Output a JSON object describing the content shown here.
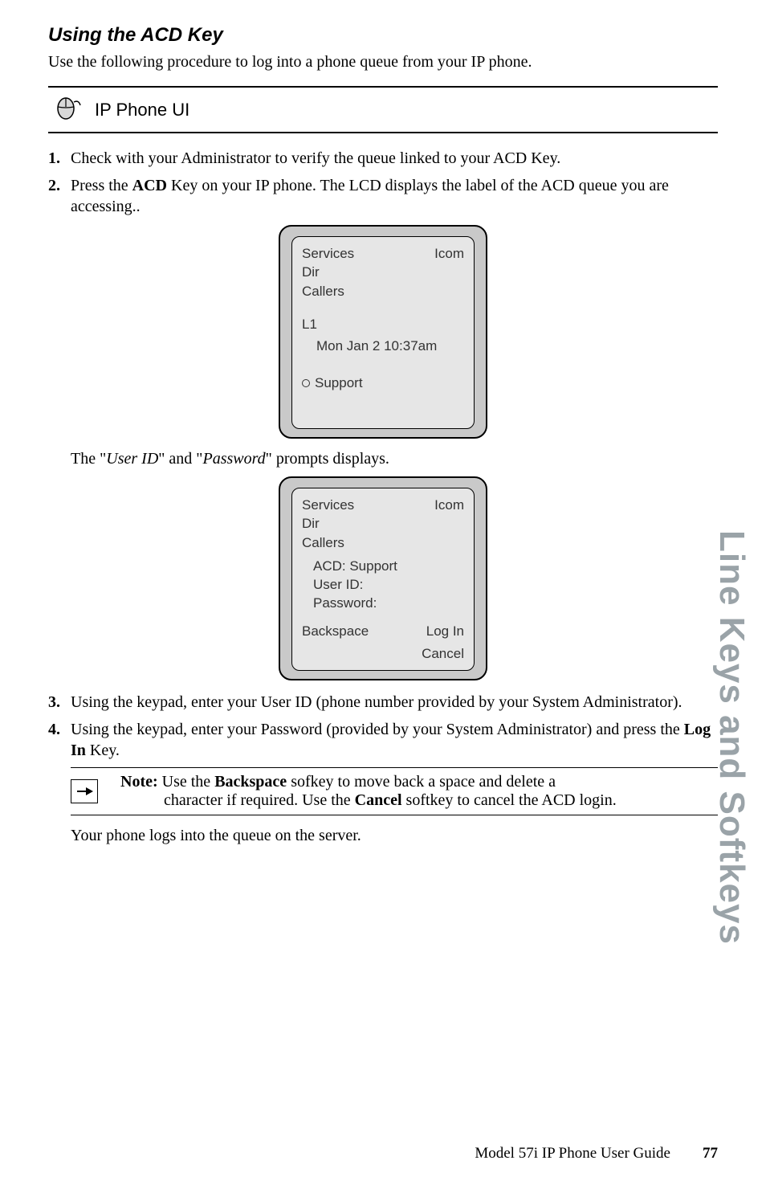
{
  "section_title": "Using the ACD Key",
  "intro": "Use the following procedure to log into a phone queue from your IP phone.",
  "ui_banner_label": "IP Phone UI",
  "steps": {
    "s1": "Check with your Administrator to verify the queue linked to your ACD Key.",
    "s2_a": "Press the ",
    "s2_b": "ACD",
    "s2_c": " Key on your IP phone. The LCD displays the label of the ACD queue you are accessing..",
    "s3": "Using the keypad, enter your User ID (phone number provided by your System Administrator).",
    "s4_a": "Using the keypad, enter your Password (provided by your System Administrator) and press the ",
    "s4_b": "Log In",
    "s4_c": " Key."
  },
  "lcd1": {
    "services": "Services",
    "icom": "Icom",
    "dir": "Dir",
    "callers": "Callers",
    "line": "L1",
    "datetime": "Mon Jan 2 10:37am",
    "support": "Support"
  },
  "prompt_text_a": "The \"",
  "prompt_text_b": "User ID",
  "prompt_text_c": "\" and \"",
  "prompt_text_d": "Password",
  "prompt_text_e": "\" prompts displays.",
  "lcd2": {
    "services": "Services",
    "icom": "Icom",
    "dir": "Dir",
    "callers": "Callers",
    "acd": "ACD: Support",
    "userid": "User ID:",
    "password": "Password:",
    "backspace": "Backspace",
    "login": "Log In",
    "cancel": "Cancel"
  },
  "note": {
    "label": "Note: ",
    "line1_a": "Use the ",
    "line1_b": "Backspace",
    "line1_c": " sofkey to move back a space and delete a ",
    "line2_a": "character if required. Use the ",
    "line2_b": "Cancel",
    "line2_c": " softkey to cancel the ACD login."
  },
  "after_note": "Your phone logs into the queue on the server.",
  "side_tab": "Line Keys and Softkeys",
  "footer_text": "Model 57i IP Phone User Guide",
  "page_number": "77"
}
